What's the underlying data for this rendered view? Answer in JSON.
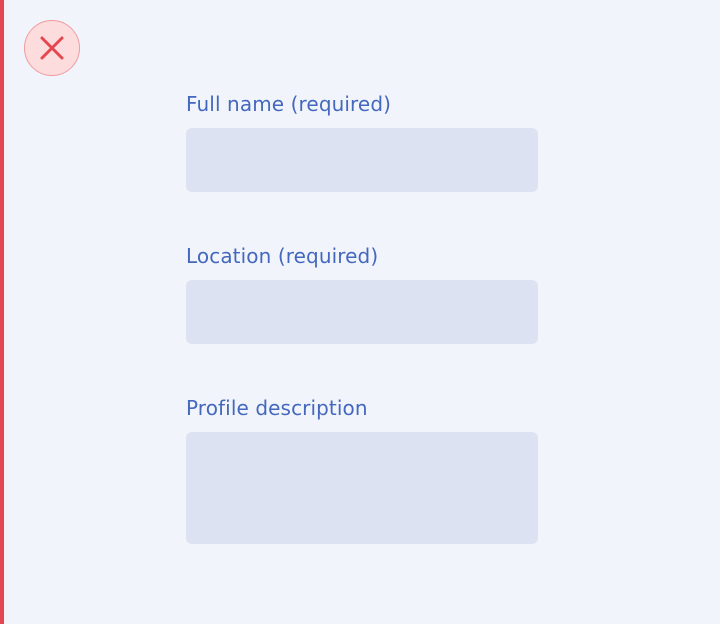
{
  "close": {
    "icon": "close-icon",
    "stroke_color": "#e34850"
  },
  "form": {
    "fields": [
      {
        "label": "Full name (required)",
        "value": "",
        "type": "text"
      },
      {
        "label": "Location (required)",
        "value": "",
        "type": "text"
      },
      {
        "label": "Profile description",
        "value": "",
        "type": "textarea"
      }
    ]
  },
  "colors": {
    "background": "#f1f5fb",
    "error_accent": "#e34850",
    "label": "#4468bd",
    "field_fill": "#dde2f3"
  }
}
